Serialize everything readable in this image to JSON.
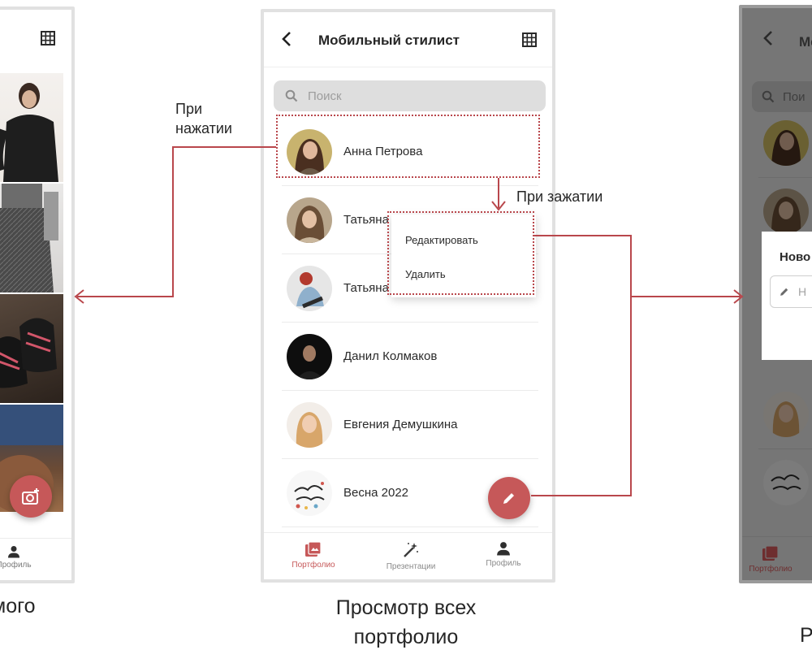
{
  "left_screen": {
    "nav_profile_label": "Профиль"
  },
  "center_screen": {
    "title": "Мобильный стилист",
    "search_placeholder": "Поиск",
    "items": [
      {
        "name": "Анна Петрова"
      },
      {
        "name": "Татьяна Нагрушкина"
      },
      {
        "name": "Татьяна"
      },
      {
        "name": "Данил Колмаков"
      },
      {
        "name": "Евгения Демушкина"
      },
      {
        "name": "Весна 2022"
      }
    ],
    "context_menu": {
      "edit": "Редактировать",
      "delete": "Удалить"
    },
    "nav": {
      "portfolio": "Портфолио",
      "presentations": "Презентации",
      "profile": "Профиль"
    }
  },
  "right_screen": {
    "title_fragment": "Ме",
    "search_fragment": "Пои",
    "dialog_title_fragment": "Ново",
    "dialog_field_fragment": "Н",
    "nav_fragment": "Портфолио"
  },
  "annotations": {
    "on_press": "При нажатии",
    "on_hold": "При зажатии",
    "caption_center": "Просмотр всех портфолио",
    "caption_left_fragment": "мого",
    "caption_right_fragment": "Р"
  },
  "colors": {
    "accent": "#c65859",
    "connector": "#b9474c",
    "overlay": "#767676"
  }
}
